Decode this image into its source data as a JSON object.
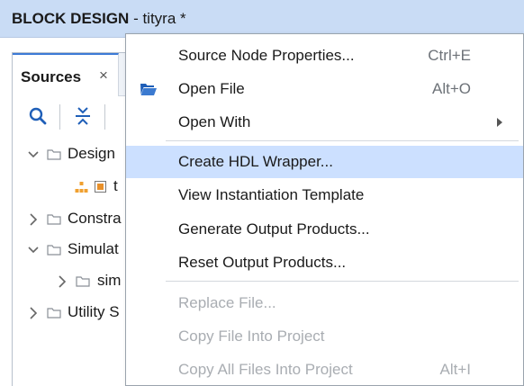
{
  "titlebar": {
    "title": "BLOCK DESIGN",
    "subtitle": " - tityra *"
  },
  "sources_panel": {
    "tab_label": "Sources",
    "close_glyph": "×",
    "toolbar_icons": [
      "search-icon",
      "collapse-all-icon"
    ],
    "tree": [
      {
        "label": "Design",
        "expanded": true,
        "icon": "folder-icon"
      },
      {
        "label": "t",
        "icon": "block-design-icon"
      },
      {
        "label": "Constra",
        "expanded": false,
        "icon": "folder-icon"
      },
      {
        "label": "Simulat",
        "expanded": true,
        "icon": "folder-icon"
      },
      {
        "label": "sim",
        "expanded": false,
        "icon": "folder-icon"
      },
      {
        "label": "Utility S",
        "expanded": false,
        "icon": "folder-icon"
      }
    ]
  },
  "context_menu": {
    "items": [
      {
        "label": "Source Node Properties...",
        "shortcut": "Ctrl+E"
      },
      {
        "label": "Open File",
        "shortcut": "Alt+O",
        "icon": "open-folder-icon"
      },
      {
        "label": "Open With",
        "submenu": true
      },
      {
        "label": "Create HDL Wrapper...",
        "highlighted": true
      },
      {
        "label": "View Instantiation Template"
      },
      {
        "label": "Generate Output Products..."
      },
      {
        "label": "Reset Output Products..."
      },
      {
        "label": "Replace File...",
        "disabled": true
      },
      {
        "label": "Copy File Into Project",
        "disabled": true
      },
      {
        "label": "Copy All Files Into Project",
        "shortcut": "Alt+I",
        "disabled": true
      }
    ]
  },
  "colors": {
    "titlebar_bg": "#c9dcf5",
    "highlight_bg": "#cce0ff",
    "accent": "#3d7ad6",
    "disabled_text": "#a9adb2"
  }
}
